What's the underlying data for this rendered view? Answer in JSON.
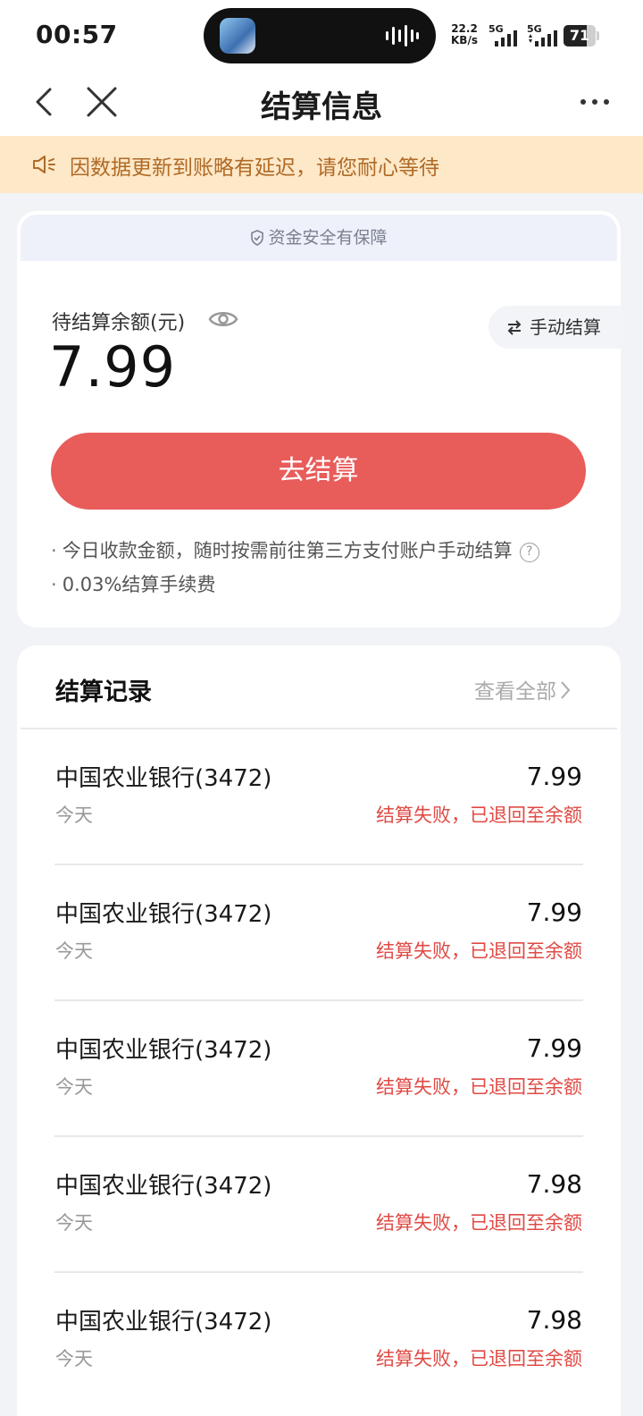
{
  "status_bar": {
    "time": "00:57",
    "net_speed_value": "22.2",
    "net_speed_unit": "KB/s",
    "sim1_label": "5G",
    "sim2_label": "5G",
    "battery_level": "71",
    "battery_fraction": 0.71
  },
  "nav": {
    "title": "结算信息"
  },
  "notice": {
    "text": "因数据更新到账略有延迟，请您耐心等待"
  },
  "balance": {
    "safety_text": "资金安全有保障",
    "label": "待结算余额(元)",
    "amount": "7.99",
    "manual_button": "手动结算",
    "settle_button": "去结算",
    "note1": "今日收款金额，随时按需前往第三方支付账户手动结算",
    "note2": "0.03%结算手续费"
  },
  "records": {
    "title": "结算记录",
    "view_all": "查看全部",
    "items": [
      {
        "bank": "中国农业银行(3472)",
        "date": "今天",
        "amount": "7.99",
        "status": "结算失败，已退回至余额"
      },
      {
        "bank": "中国农业银行(3472)",
        "date": "今天",
        "amount": "7.99",
        "status": "结算失败，已退回至余额"
      },
      {
        "bank": "中国农业银行(3472)",
        "date": "今天",
        "amount": "7.99",
        "status": "结算失败，已退回至余额"
      },
      {
        "bank": "中国农业银行(3472)",
        "date": "今天",
        "amount": "7.98",
        "status": "结算失败，已退回至余额"
      },
      {
        "bank": "中国农业银行(3472)",
        "date": "今天",
        "amount": "7.98",
        "status": "结算失败，已退回至余额"
      }
    ]
  },
  "colors": {
    "accent": "#e85c5a",
    "failure_text": "#e04a44",
    "notice_bg": "#fde8c8",
    "notice_text": "#b06a25"
  }
}
